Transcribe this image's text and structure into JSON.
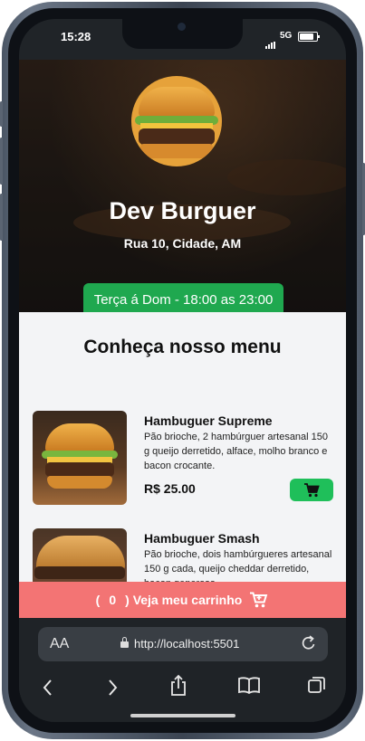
{
  "status_bar": {
    "time": "15:28",
    "network": "5G"
  },
  "restaurant": {
    "name": "Dev Burguer",
    "address": "Rua 10, Cidade, AM",
    "hours": "Terça á Dom - 18:00 as 23:00"
  },
  "menu": {
    "title": "Conheça nosso menu",
    "items": [
      {
        "name": "Hambuguer Supreme",
        "description": "Pão brioche, 2 hambúrguer artesanal 150 g queijo derretido, alface, molho branco e bacon crocante.",
        "price": "R$ 25.00"
      },
      {
        "name": "Hambuguer Smash",
        "description": "Pão brioche, dois hambúrgueres artesanal 150 g cada, queijo cheddar derretido, bacon generoso"
      }
    ]
  },
  "cart": {
    "open_paren": "(",
    "count": "0",
    "label": ") Veja meu carrinho"
  },
  "browser": {
    "text_size_label": "AA",
    "url": "http://localhost:5501"
  },
  "colors": {
    "hours_bg": "#1fa84f",
    "add_button": "#1fbf5a",
    "cart_bar": "#f37474",
    "menu_bg": "#f3f4f6"
  },
  "icons": [
    "cart-icon",
    "lock-icon",
    "reload-icon",
    "back-icon",
    "forward-icon",
    "share-icon",
    "bookmarks-icon",
    "tabs-icon"
  ]
}
